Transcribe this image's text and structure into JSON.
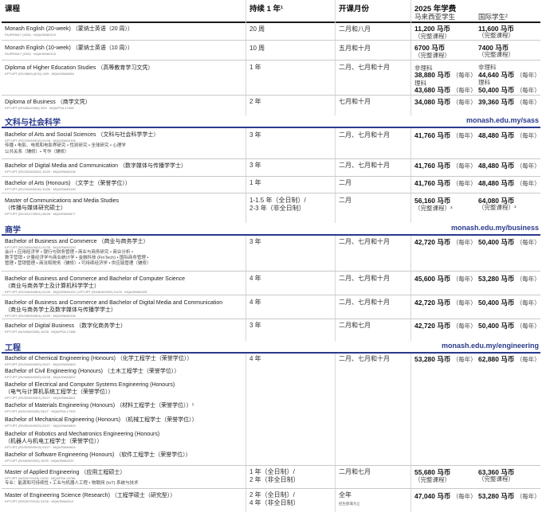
{
  "header": {
    "course": "课程",
    "duration": "持续 1 年¹",
    "intake": "开课月份",
    "fees": "2025 年学费",
    "malaysian": "马来西亚学生",
    "international": "国际学生²"
  },
  "sections": {
    "sass": {
      "title": "文科与社会科学",
      "url": "monash.edu.my/sass"
    },
    "business": {
      "title": "商学",
      "url": "monash.edu.my/business"
    },
    "engineering": {
      "title": "工程",
      "url": "monash.edu.my/engineering"
    }
  },
  "rows": [
    {
      "name": "Monash English (20-week) （蒙纳士英语（20 周））",
      "code": "FAJRF6617 (0/20) · MQA/SWA0119",
      "duration": "20 周",
      "intake": "二月和八月",
      "fee_my": "11,200 马币",
      "fee_my_note": "（完整课程）",
      "fee_int": "11,600 马币",
      "fee_int_note": "（完整课程）"
    },
    {
      "name": "Monash English (10-week) （蒙纳士英语（10 周））",
      "code": "FAJRF6617 (0/20) · MQA/SWA0119",
      "duration": "10 周",
      "intake": "五月和十月",
      "fee_my": "6700 马币",
      "fee_my_note": "（完整课程）",
      "fee_int": "7400 马币",
      "fee_int_note": "（完整课程）"
    },
    {
      "name": "Diploma of Higher Education Studies （高等教育学习文凭）",
      "code": "KPT/JPT (R2/4569) (6/31) 3/29 · MQA/SWA0654",
      "duration": "1 年",
      "intake": "二月、七月和十月",
      "fee_my_a_label": "非理科",
      "fee_my_a": "38,880 马币",
      "fee_my_a_unit": "（每年）",
      "fee_my_b_label": "理科",
      "fee_my_b": "43,680 马币",
      "fee_my_b_unit": "（每年）",
      "fee_int_a_label": "非理科",
      "fee_int_a": "44,640 马币",
      "fee_int_a_unit": "（每年）",
      "fee_int_b_label": "理科",
      "fee_int_b": "50,400 马币",
      "fee_int_b_unit": "（每年）"
    },
    {
      "name": "Diploma of Business （商学文凭）",
      "code": "KPT/JPT (R/345/4/0308) 3/29 · MQA/PSA 17908",
      "duration": "2 年",
      "intake": "七月和十月",
      "fee_my": "34,080 马币",
      "fee_my_unit": "（每年）",
      "fee_int": "39,360 马币",
      "fee_int_unit": "（每年）"
    },
    {
      "name": "Bachelor of Arts and Social Sciences （文科与社会科学学士）",
      "code": "KPT/JPT (R2/220/6/0016) 01/26 · MQA/SWA0105",
      "note1": "传播 • 电影、电视和电影界研究 • 性别研究 • 全球研究 • 心理学",
      "note2": "公共关系（辅修）• 写作（辅修）",
      "duration": "3 年",
      "intake": "二月、七月和十月",
      "fee_my": "41,760 马币",
      "fee_my_unit": "（每年）",
      "fee_int": "48,480 马币",
      "fee_int_unit": "（每年）"
    },
    {
      "name": "Bachelor of Digital Media and Communication （数字媒体与传播学学士）",
      "code": "KPT/JPT (R2/322/6/0032) 10/29 · MQA/SWA0106",
      "duration": "3 年",
      "intake": "二月、七月和十月",
      "fee_my": "41,760 马币",
      "fee_my_unit": "（每年）",
      "fee_int": "48,480 马币",
      "fee_int_unit": "（每年）"
    },
    {
      "name": "Bachelor of Arts (Honours) （文学士（荣誉学位））",
      "code": "KPT/JPT (R2/220/6/0016) 10/26 · MQA/SWA0100",
      "duration": "1 年",
      "intake": "二月",
      "fee_my": "41,760 马币",
      "fee_my_unit": "（每年）",
      "fee_int": "48,480 马币",
      "fee_int_unit": "（每年）"
    },
    {
      "name": "Master of Communications and Media Studies",
      "name2": "（传播与媒体研究硕士）",
      "code": "KPT/JPT (R2/321/7/0001) 08/26 · MQA/SWA0877",
      "duration": "1-1.5 年（全日制）/",
      "duration2": "2-3 年（非全日制）",
      "intake": "二月",
      "fee_my": "56,160 马币",
      "fee_my_note": "（完整课程）³",
      "fee_int": "64,080 马币",
      "fee_int_note": "（完整课程）³"
    },
    {
      "name": "Bachelor of Business and Commerce （商业与商务学士）",
      "code": "KPT/JPT (R2/340/6/0624) 01/30 · MQA/SWA0100",
      "note1": "会计 • 应用经济学 • 银行与财务管理 • 商业与商务研究 • 商业分析 •",
      "note2": "数字营销 • 计量经济学与商业统计学 • 金融科技 (FinTech) • 国际商务管理 •",
      "note3": "管理 • 营销管理 • 商法和税务（辅修）• 可持续经济学 • 供应链管理（辅修）",
      "duration": "3 年",
      "intake": "二月、七月和十月",
      "fee_my": "42,720 马币",
      "fee_my_unit": "（每年）",
      "fee_int": "50,400 马币",
      "fee_int_unit": "（每年）"
    },
    {
      "name": "Bachelor of Business and Commerce and Bachelor of Computer Science",
      "name2": "（商业与商务学士及计算机科学学士）",
      "code": "KPT/JPT (R2/340/6/0624) 01/30 · MQA/SWA0100 | KPT/JPT (R/481/6/0033) 01/25 · MQA/SWA0225",
      "duration": "4 年",
      "intake": "二月、七月和十月",
      "fee_my": "45,600 马币",
      "fee_my_unit": "（每年）",
      "fee_int": "53,280 马币",
      "fee_int_unit": "（每年）"
    },
    {
      "name": "Bachelor of Business and Commerce and Bachelor of Digital Media and Communication",
      "name2": "（商业与商务学士及数字媒体与传播学学士）",
      "code": "KPT/JPT (R2/340/6/0624) 10/29 · MQA/SWA0106",
      "duration": "4 年",
      "intake": "二月、七月和十月",
      "fee_my": "42,720 马币",
      "fee_my_unit": "（每年）",
      "fee_int": "50,400 马币",
      "fee_int_unit": "（每年）"
    },
    {
      "name": "Bachelor of Digital Business （数字化商务学士）",
      "code": "KPT/JPT (N/345/6/0328) 10/28 · MQA/PSA 17488",
      "duration": "3 年",
      "intake": "二月和七月",
      "fee_my": "42,720 马币",
      "fee_my_unit": "（每年）",
      "fee_int": "50,400 马币",
      "fee_int_unit": "（每年）"
    },
    {
      "name": "Bachelor of Chemical Engineering (Honours) （化学工程学士（荣誉学位））",
      "code": "KPT/JPT (R2/524/6/0003) 03/27 · MQA/SWA0600",
      "duration": "4 年",
      "intake": "二月、七月和十月",
      "fee_my": "53,280 马币",
      "fee_my_unit": "（每年）",
      "fee_int": "62,880 马币",
      "fee_int_unit": "（每年）"
    },
    {
      "name": "Bachelor of Civil Engineering (Honours) （土木工程学士（荣誉学位））",
      "code": "KPT/JPT (R2/526/6/0030) 03/26 · MQA/SWA0602"
    },
    {
      "name": "Bachelor of Electrical and Computer Systems Engineering (Honours)",
      "name2": "（电气与计算机系统工程学士（荣誉学位））",
      "code": "KPT/JPT (R2/523/6/0001) 05/27 · MQA/SWA0601"
    },
    {
      "name": "Bachelor of Materials Engineering (Honours) （材料工程学士（荣誉学位））⁵",
      "code": "KPT/JPT (N/521/6/0035) 03/27 · MQA/PSA 17325"
    },
    {
      "name": "Bachelor of Mechanical Engineering (Honours) （机械工程学士（荣誉学位））",
      "code": "KPT/JPT (R2/521/6/0033) 03/27 · MQA/SWA0603"
    },
    {
      "name": "Bachelor of Robotics and Mechatronics Engineering (Honours)",
      "name2": "（机器人与机电工程学士（荣誉学位））",
      "code": "KPT/JPT (R2/523/6/0013) 03/27 · MQA/SWA0604"
    },
    {
      "name": "Bachelor of Software Engineering (Honours) （软件工程学士（荣誉学位））",
      "code": "KPT/JPT (R/481/6/0003) 10/25 · MQA/SWA0220"
    },
    {
      "name": "Master of Applied Engineering （应用工程硕士）",
      "code": "KPT/JPT (N/520/7/0118) 10/28 · MQA/PSA 15768",
      "note1": "专业：能源和可持续性 • 工业与机器人工程 • 物联网 (IoT) 系统与技术",
      "duration": "1 年（全日制）/",
      "duration2": "2 年（非全日制）",
      "intake": "二月和七月",
      "fee_my": "55,680 马币",
      "fee_my_note": "（完整课程）",
      "fee_int": "63,360 马币",
      "fee_int_note": "（完整课程）"
    },
    {
      "name": "Master of Engineering Science (Research) （工程学硕士（研究型））",
      "code": "KPT/JPT (R/520/7/0010) 01/28 · MQA/SWA0112",
      "duration": "2 年（全日制）/",
      "duration2": "4 年（非全日制）",
      "intake": "全年",
      "intake_note": "招生额满为止",
      "fee_my": "47,040 马币",
      "fee_my_unit": "（每年）",
      "fee_int": "53,280 马币",
      "fee_int_unit": "（每年）"
    }
  ]
}
